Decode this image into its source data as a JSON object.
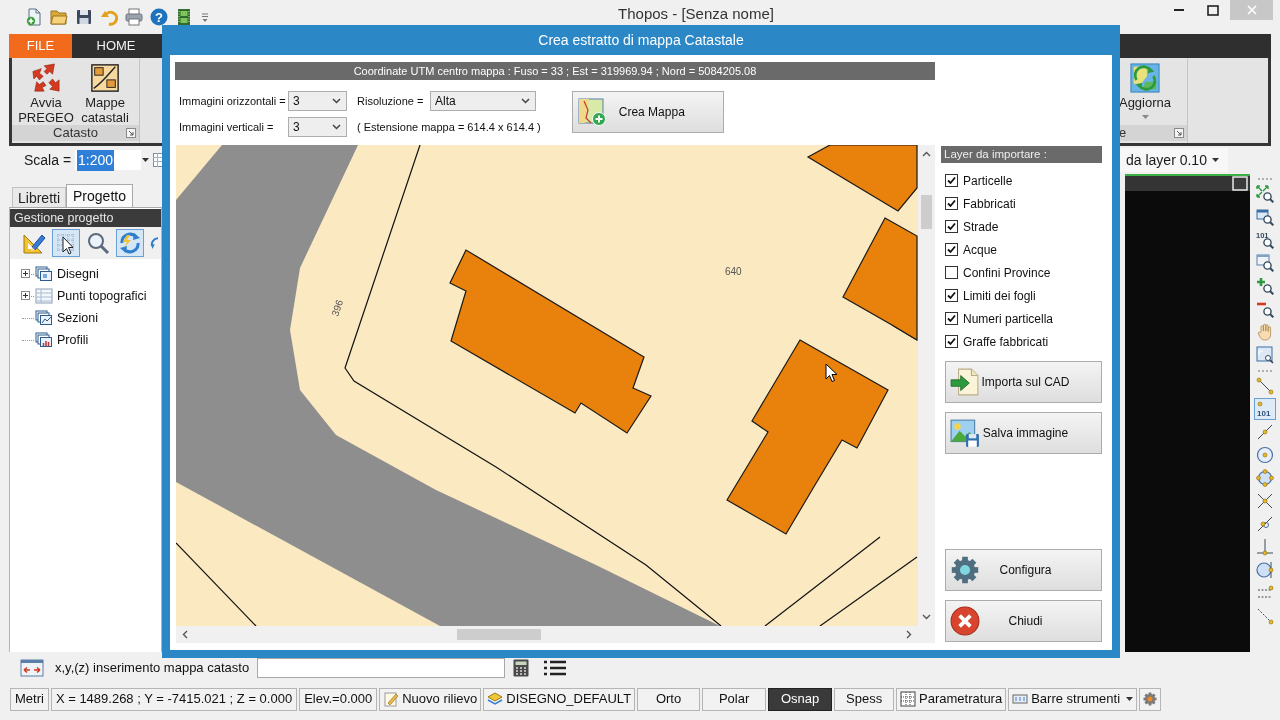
{
  "app": {
    "title": "Thopos - [Senza nome]",
    "quick_access": [
      {
        "kind": "new"
      },
      {
        "kind": "open"
      },
      {
        "kind": "save"
      },
      {
        "kind": "undo"
      },
      {
        "kind": "print"
      },
      {
        "kind": "help",
        "glyph": "?"
      },
      {
        "kind": "film"
      },
      {
        "kind": "customize"
      }
    ]
  },
  "ribbon": {
    "tabs": [
      {
        "label": "FILE",
        "kind": "file"
      },
      {
        "label": "HOME",
        "kind": "tab"
      }
    ],
    "groups": [
      {
        "label": "Catasto",
        "buttons": [
          {
            "label": "Avvia PREGEO",
            "kind": "pregeo",
            "dropdown": false
          },
          {
            "label": "Mappe catastali",
            "kind": "cadastral-map",
            "dropdown": false
          }
        ]
      },
      {
        "label": "e",
        "buttons": [
          {
            "label": "Aggiorna",
            "kind": "refresh",
            "dropdown": true
          }
        ]
      }
    ]
  },
  "scale_bar": {
    "label": "Scala =",
    "value": "1:200",
    "value_selected": true,
    "layer_value": "da layer 0.10"
  },
  "left_panel": {
    "tabs": [
      {
        "label": "Libretti",
        "selected": false
      },
      {
        "label": "Progetto",
        "selected": true
      }
    ],
    "title": "Gestione progetto",
    "toolbar": [
      {
        "kind": "drafting",
        "selected": false
      },
      {
        "kind": "select",
        "selected": true
      },
      {
        "kind": "zoom",
        "selected": false
      },
      {
        "kind": "refresh",
        "selected": true
      },
      {
        "kind": "refresh-partial",
        "selected": false
      }
    ],
    "tree": [
      {
        "label": "Disegni",
        "expanded": false
      },
      {
        "label": "Punti topografici",
        "expanded": false
      },
      {
        "label": "Sezioni"
      },
      {
        "label": "Profili"
      }
    ]
  },
  "right_toolbar": {
    "zoom": [
      {
        "kind": "zoom-extents",
        "selected": false
      },
      {
        "kind": "zoom-window",
        "selected": false
      },
      {
        "kind": "zoom-number",
        "glyph": "101",
        "selected": false
      },
      {
        "kind": "zoom-previous",
        "selected": false
      },
      {
        "kind": "zoom-in",
        "selected": false
      },
      {
        "kind": "zoom-out",
        "selected": false
      },
      {
        "kind": "pan",
        "selected": false
      },
      {
        "kind": "zoom-frame",
        "selected": false
      }
    ],
    "snap": [
      {
        "kind": "snap-end",
        "selected": false
      },
      {
        "kind": "snap-number",
        "glyph": "101",
        "selected": true
      },
      {
        "kind": "snap-mid",
        "selected": false
      },
      {
        "kind": "snap-center",
        "selected": false
      },
      {
        "kind": "snap-quadrant",
        "selected": false
      },
      {
        "kind": "snap-intersection",
        "selected": false
      },
      {
        "kind": "snap-node",
        "selected": false
      },
      {
        "kind": "snap-perpendicular",
        "selected": false
      },
      {
        "kind": "snap-tangent",
        "selected": false
      },
      {
        "kind": "snap-parallel",
        "selected": false
      },
      {
        "kind": "snap-nearest",
        "selected": false
      }
    ]
  },
  "command_line": {
    "prompt": "x,y,(z) inserimento mappa catasto"
  },
  "status_bar": [
    {
      "label": "Metri",
      "kind": "text"
    },
    {
      "label": "X = 1489.268 ; Y = -7415.021 ; Z = 0.000",
      "kind": "text"
    },
    {
      "label": "Elev.=0.000",
      "kind": "text"
    },
    {
      "label": "Nuovo rilievo",
      "kind": "survey"
    },
    {
      "label": "DISEGNO_DEFAULT",
      "kind": "layer"
    },
    {
      "label": "Orto",
      "kind": "toggle",
      "on": false
    },
    {
      "label": "Polar",
      "kind": "toggle",
      "on": false
    },
    {
      "label": "Osnap",
      "kind": "toggle",
      "on": true
    },
    {
      "label": "Spess",
      "kind": "toggle",
      "on": false
    },
    {
      "label": "Parametratura",
      "kind": "grid"
    },
    {
      "label": "Barre strumenti",
      "kind": "menu"
    },
    {
      "kind": "settings"
    }
  ],
  "dialog": {
    "title": "Crea estratto di mappa Catastale",
    "coordinates": "Coordinate UTM centro mappa : Fuso = 33 ; Est = 319969.94 ; Nord = 5084205.08",
    "horizontal_images": {
      "label": "Immagini orizzontali =",
      "value": "3"
    },
    "resolution": {
      "label": "Risoluzione =",
      "value": "Alta"
    },
    "vertical_images": {
      "label": "Immagini verticali =",
      "value": "3"
    },
    "extent": "( Estensione mappa = 614.4 x 614.4 )",
    "create_button": "Crea Mappa",
    "map": {
      "parcel_numbers": [
        "396",
        "640"
      ]
    },
    "layers_title": "Layer da importare :",
    "layers": [
      {
        "label": "Particelle",
        "checked": true
      },
      {
        "label": "Fabbricati",
        "checked": true
      },
      {
        "label": "Strade",
        "checked": true
      },
      {
        "label": "Acque",
        "checked": true
      },
      {
        "label": "Confini Province",
        "checked": false
      },
      {
        "label": "Limiti dei fogli",
        "checked": true
      },
      {
        "label": "Numeri particella",
        "checked": true
      },
      {
        "label": "Graffe fabbricati",
        "checked": true
      }
    ],
    "actions": [
      {
        "label": "Importa sul CAD",
        "kind": "import"
      },
      {
        "label": "Salva immagine",
        "kind": "save-image"
      }
    ],
    "footer_actions": [
      {
        "label": "Configura",
        "kind": "configure"
      },
      {
        "label": "Chiudi",
        "kind": "close"
      }
    ]
  }
}
